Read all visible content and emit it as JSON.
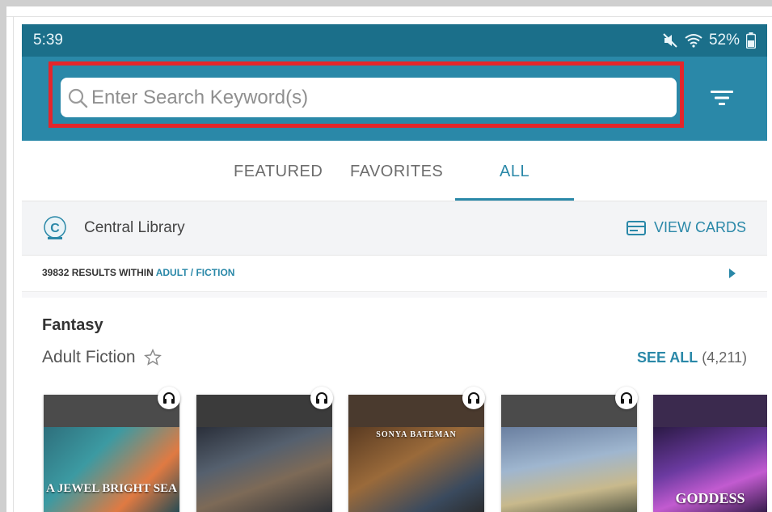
{
  "status_bar": {
    "time": "5:39",
    "battery": "52%"
  },
  "search": {
    "placeholder": "Enter Search Keyword(s)",
    "value": ""
  },
  "tabs": [
    {
      "label": "FEATURED",
      "active": false
    },
    {
      "label": "FAVORITES",
      "active": false
    },
    {
      "label": "ALL",
      "active": true
    }
  ],
  "library": {
    "name": "Central Library",
    "view_cards_label": "VIEW CARDS"
  },
  "results": {
    "prefix": "39832 RESULTS WITHIN",
    "filter": "ADULT / FICTION"
  },
  "shelf": {
    "genre": "Fantasy",
    "subtitle": "Adult Fiction",
    "see_all_label": "SEE ALL",
    "see_all_count": "(4,211)"
  },
  "books": [
    {
      "cover_text": "A JEWEL BRIGHT SEA",
      "icon": "headphones-icon",
      "audio": true
    },
    {
      "cover_text": "",
      "icon": "headphones-icon",
      "audio": true
    },
    {
      "cover_text": "SONYA BATEMAN",
      "icon": "headphones-icon",
      "audio": true
    },
    {
      "cover_text": "",
      "icon": "headphones-icon",
      "audio": true
    },
    {
      "cover_text": "GODDESS",
      "icon": "",
      "audio": false
    }
  ],
  "colors": {
    "status_bar": "#1b6f8a",
    "app_bar": "#2a88a8",
    "accent": "#2a88a8",
    "highlight_border": "#e3262b"
  }
}
